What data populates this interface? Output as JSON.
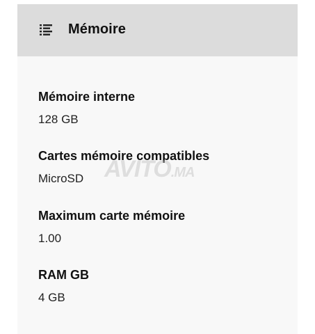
{
  "section": {
    "title": "Mémoire",
    "icon": "list-icon"
  },
  "specs": [
    {
      "label": "Mémoire interne",
      "value": "128 GB"
    },
    {
      "label": "Cartes mémoire compatibles",
      "value": "MicroSD"
    },
    {
      "label": "Maximum carte mémoire",
      "value": "1.00"
    },
    {
      "label": "RAM GB",
      "value": "4 GB"
    }
  ],
  "watermark": {
    "text": "AVITO",
    "suffix": ".MA"
  },
  "colors": {
    "header_bg": "#dcdcdc",
    "card_bg": "#f8f8f8",
    "text": "#111111"
  }
}
